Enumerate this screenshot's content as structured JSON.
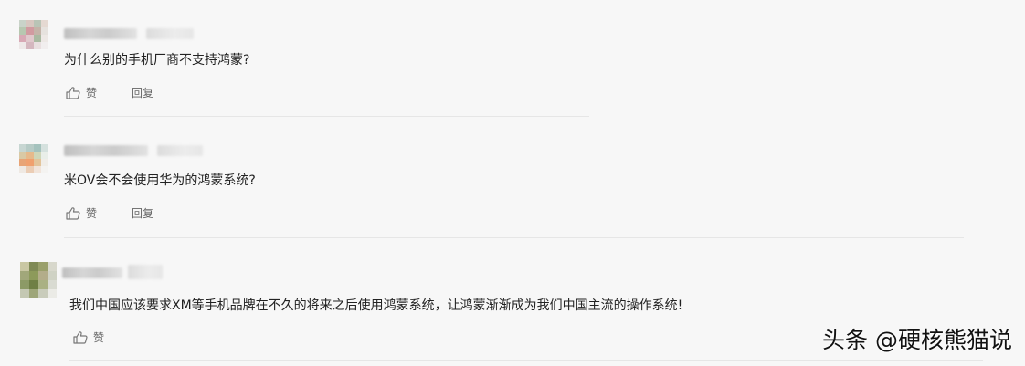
{
  "comments": [
    {
      "text": "为什么别的手机厂商不支持鸿蒙?",
      "like_label": "赞",
      "reply_label": "回复"
    },
    {
      "text": "米OV会不会使用华为的鸿蒙系统?",
      "like_label": "赞",
      "reply_label": "回复"
    },
    {
      "text": "我们中国应该要求XM等手机品牌在不久的将来之后使用鸿蒙系统，让鸿蒙渐渐成为我们中国主流的操作系统!",
      "like_label": "赞"
    }
  ],
  "watermark": "头条 @硬核熊猫说",
  "colors": {
    "background": "#f7f7f7",
    "text": "#222222",
    "action_text": "#666666",
    "divider": "#e6e6e6"
  },
  "icons": [
    "thumbs-up-icon"
  ]
}
